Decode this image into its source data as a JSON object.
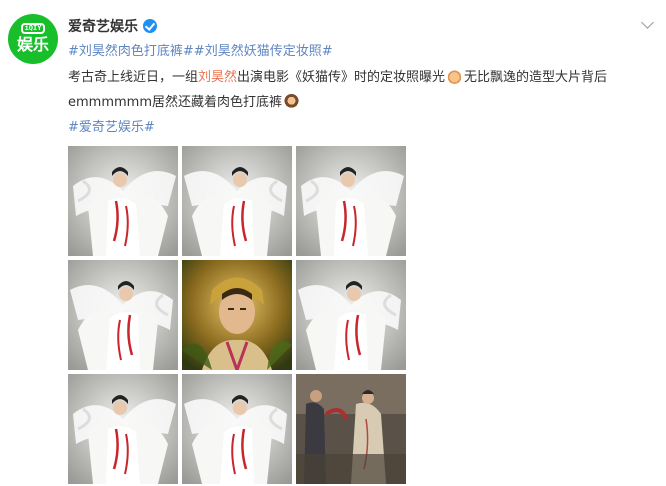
{
  "account": {
    "avatar_logo_top": "iQIY",
    "avatar_logo_text": "娱乐",
    "name": "爱奇艺娱乐"
  },
  "post": {
    "hashtags_line": {
      "tag1": "#刘昊然肉色打底裤#",
      "tag2": "#刘昊然妖猫传定妆照#"
    },
    "body_line1": {
      "part1": "考古奇上线近日，一组",
      "mention": "刘昊然",
      "part2": "出演电影《妖猫传》时的定妆照曝光",
      "part3": "无比飘逸的造型大片背后"
    },
    "body_line2": {
      "part1": "emmmmmm居然还藏着肉色打底裤"
    },
    "footer_tag": "#爱奇艺娱乐#"
  },
  "photos": [
    {
      "name": "photo-white-costume-1",
      "kind": "white"
    },
    {
      "name": "photo-white-costume-2",
      "kind": "white"
    },
    {
      "name": "photo-white-costume-3",
      "kind": "white"
    },
    {
      "name": "photo-white-costume-4",
      "kind": "white"
    },
    {
      "name": "photo-golden-portrait",
      "kind": "gold"
    },
    {
      "name": "photo-white-costume-5",
      "kind": "white"
    },
    {
      "name": "photo-white-costume-6",
      "kind": "white"
    },
    {
      "name": "photo-white-costume-7",
      "kind": "white"
    },
    {
      "name": "photo-behind-scenes",
      "kind": "bts"
    }
  ],
  "colors": {
    "brand_green": "#18bf2b",
    "tag_orange": "#eb7350",
    "link_blue": "#5e86c1",
    "verified_blue": "#1f8ff5",
    "costume_red": "#c8262c"
  },
  "icons": {
    "verified": "verified-badge-icon",
    "expand": "chevron-down-icon",
    "emoji1": "emoji-hand-icon",
    "emoji2": "emoji-monkey-icon"
  }
}
